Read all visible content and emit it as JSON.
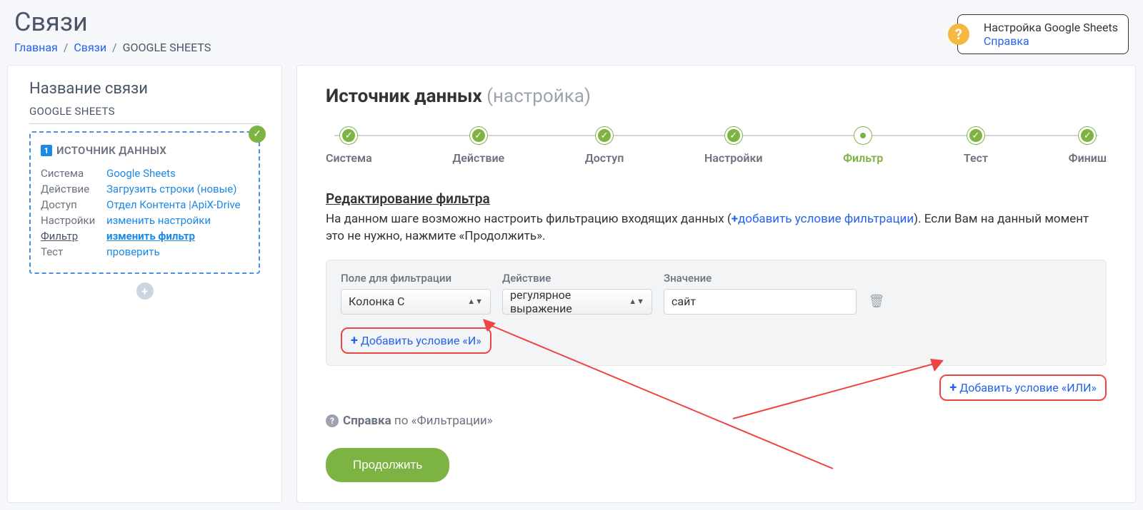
{
  "page": {
    "title": "Связи",
    "breadcrumb": {
      "home": "Главная",
      "links": "Связи",
      "current": "GOOGLE SHEETS"
    }
  },
  "help_badge": {
    "title": "Настройка Google Sheets",
    "link": "Справка"
  },
  "sidebar": {
    "heading": "Название связи",
    "subtitle": "GOOGLE SHEETS",
    "source_box": {
      "title": "ИСТОЧНИК ДАННЫХ",
      "rows": [
        {
          "key": "Система",
          "value": "Google Sheets",
          "active": false
        },
        {
          "key": "Действие",
          "value": "Загрузить строки (новые)",
          "active": false
        },
        {
          "key": "Доступ",
          "value": "Отдел Контента |ApiX-Drive",
          "active": false
        },
        {
          "key": "Настройки",
          "value": "изменить настройки",
          "active": false
        },
        {
          "key": "Фильтр",
          "value": "изменить фильтр",
          "active": true
        },
        {
          "key": "Тест",
          "value": "проверить",
          "active": false
        }
      ]
    }
  },
  "content": {
    "title_main": "Источник данных",
    "title_muted": "(настройка)",
    "steps": [
      {
        "label": "Система",
        "state": "done"
      },
      {
        "label": "Действие",
        "state": "done"
      },
      {
        "label": "Доступ",
        "state": "done"
      },
      {
        "label": "Настройки",
        "state": "done"
      },
      {
        "label": "Фильтр",
        "state": "active"
      },
      {
        "label": "Тест",
        "state": "done"
      },
      {
        "label": "Финиш",
        "state": "done"
      }
    ],
    "filter_editing": {
      "title": "Редактирование фильтра",
      "desc_pre": "На данном шаге возможно настроить фильтрацию входящих данных (",
      "desc_link": "добавить условие фильтрации",
      "desc_post": "). Если Вам на данный момент это не нужно, нажмите «Продолжить»."
    },
    "filter_panel": {
      "field_label": "Поле для фильтрации",
      "field_value": "Колонка С",
      "action_label": "Действие",
      "action_value": "регулярное выражение",
      "value_label": "Значение",
      "value_value": "сайт",
      "add_and": "Добавить условие «И»"
    },
    "add_or": "Добавить условие «ИЛИ»",
    "help_line": {
      "text_pre": "Справка",
      "text_post": " по «Фильтрации»"
    },
    "continue": "Продолжить"
  }
}
